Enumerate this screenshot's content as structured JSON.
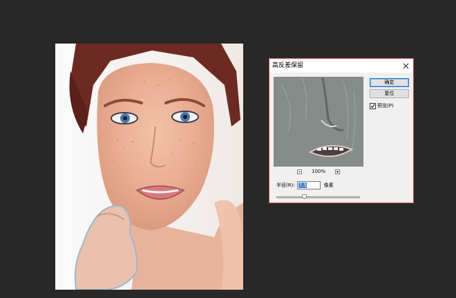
{
  "dialog": {
    "title": "高反差保留",
    "ok_label": "确定",
    "reset_label": "复位",
    "preview_label": "预览(P)",
    "preview_checked": true,
    "zoom_level": "100%",
    "radius_label": "半径(R):",
    "radius_value": "7.5",
    "unit_label": "像素",
    "slider_fraction": 0.33
  },
  "icons": {
    "close": "close-icon",
    "zoom_out": "minus-icon",
    "zoom_in": "plus-icon",
    "check": "checkmark-icon"
  },
  "colors": {
    "workspace_bg": "#282828",
    "dialog_bg": "#f0f0f0",
    "dialog_border": "#c94a4a",
    "primary_button_border": "#2b74c9",
    "selection_blue": "#3f7fd1"
  }
}
